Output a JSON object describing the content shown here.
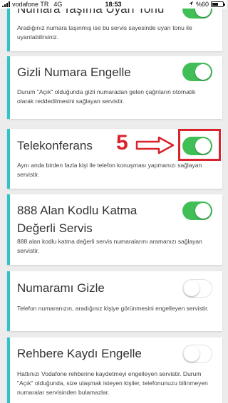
{
  "status_bar": {
    "carrier": "vodafone TR",
    "network": "4G",
    "time": "18:53",
    "battery": "%60",
    "battery_level": 0.6
  },
  "items": [
    {
      "title": "Numara Taşıma Uyarı Tonu",
      "description": "Aradığınız numara taşınmış ise bu servis sayesinde uyarı tonu ile uyarılabilirsiniz.",
      "enabled": true
    },
    {
      "title": "Gizli Numara Engelle",
      "description": "Durum \"Açık\" olduğunda gizli numaradan gelen çağrıların otomatik olarak reddedilmesini sağlayan servistir.",
      "enabled": true
    },
    {
      "title": "Telekonferans",
      "description": "Aynı anda birden fazla kişi ile telefon konuşması yapmanızı sağlayan servistir.",
      "enabled": true
    },
    {
      "title": "888 Alan Kodlu Katma Değerli Servis",
      "description": "888 alan kodlu katma değerli servis numaralarını aramanızı sağlayan servistir.",
      "enabled": true
    },
    {
      "title": "Numaramı Gizle",
      "description": "Telefon numaranızın, aradığınız kişiye görünmesini engelleyen servistir.",
      "enabled": false
    },
    {
      "title": "Rehbere Kaydı Engelle",
      "description": "Hattınızı Vodafone rehberine kaydetmeyi engelleyen servistir. Durum \"Açık\" olduğunda, size ulaşmak isteyen kişiler, telefonunuzu bilinmeyen numaralar servisinden bulamazlar.",
      "enabled": false
    }
  ],
  "annotation": {
    "number": "5",
    "color": "#d9232d"
  },
  "colors": {
    "accent": "#2ec4c8",
    "toggle_on": "#3fbf55",
    "background": "#ececec"
  }
}
